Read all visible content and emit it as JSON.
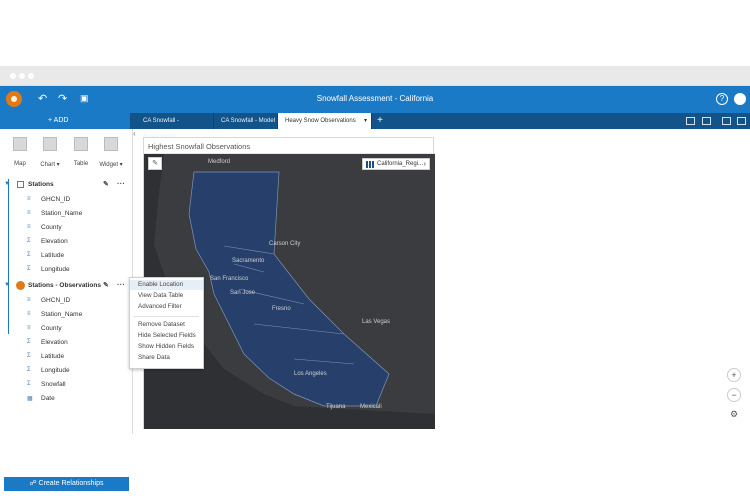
{
  "app": {
    "title": "Snowfall Assessment - California",
    "add_label": "+ ADD",
    "help_label": "?"
  },
  "tabs": [
    {
      "label": "CA Snowfall - Assessment"
    },
    {
      "label": "CA Snowfall - Model"
    },
    {
      "label": "Heavy Snow Observations",
      "active": true
    }
  ],
  "viz_buttons": [
    {
      "label": "Map"
    },
    {
      "label": "Chart ▾"
    },
    {
      "label": "Table"
    },
    {
      "label": "Widget ▾"
    }
  ],
  "datasets": [
    {
      "name": "Stations",
      "fields": [
        {
          "icon": "abc-icon",
          "name": "GHCN_ID"
        },
        {
          "icon": "abc-icon",
          "name": "Station_Name"
        },
        {
          "icon": "abc-icon",
          "name": "County"
        },
        {
          "icon": "sigma-icon",
          "name": "Elevation"
        },
        {
          "icon": "sigma-icon",
          "name": "Latitude"
        },
        {
          "icon": "sigma-icon",
          "name": "Longitude"
        }
      ]
    },
    {
      "name": "Stations - Observations",
      "fields": [
        {
          "icon": "abc-icon",
          "name": "GHCN_ID"
        },
        {
          "icon": "abc-icon",
          "name": "Station_Name"
        },
        {
          "icon": "abc-icon",
          "name": "County"
        },
        {
          "icon": "sigma-icon",
          "name": "Elevation"
        },
        {
          "icon": "sigma-icon",
          "name": "Latitude"
        },
        {
          "icon": "sigma-icon",
          "name": "Longitude"
        },
        {
          "icon": "sigma-icon",
          "name": "Snowfall"
        },
        {
          "icon": "calendar-icon",
          "name": "Date"
        }
      ]
    }
  ],
  "create_relationships_label": "Create Relationships",
  "context_menu": {
    "items": [
      {
        "label": "Enable Location"
      },
      {
        "label": "View Data Table"
      },
      {
        "label": "Advanced Filter"
      },
      {
        "label": "Remove Dataset"
      },
      {
        "label": "Hide Selected Fields"
      },
      {
        "label": "Show Hidden Fields"
      },
      {
        "label": "Share Data"
      }
    ]
  },
  "card": {
    "title": "Highest Snowfall Observations",
    "legend_label": "California_Regi..."
  },
  "map": {
    "cities": [
      "Medford",
      "Carson City",
      "Sacramento",
      "San Francisco",
      "San Jose",
      "Fresno",
      "Las Vegas",
      "Los Angeles",
      "Tijuana",
      "Mexicali"
    ],
    "region_color": "#27406b",
    "outline_color": "#7f93b3"
  },
  "zoom": {
    "in": "+",
    "out": "−"
  }
}
